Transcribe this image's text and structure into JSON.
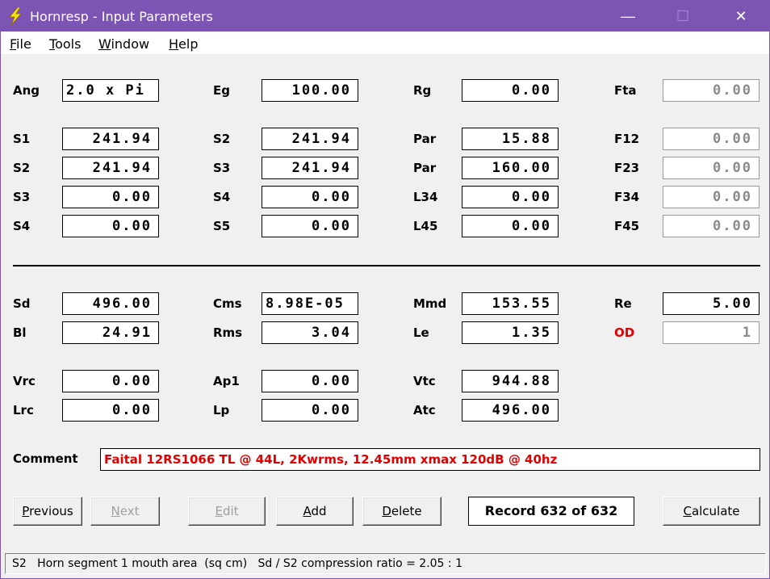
{
  "window": {
    "title": "Hornresp - Input Parameters",
    "icon": "lightning-bolt-icon",
    "title_bar_color": "#7b54b4",
    "minimize": "—",
    "maximize": "☐",
    "close": "✕"
  },
  "menu": {
    "file": {
      "key": "F",
      "rest": "ile"
    },
    "tools": {
      "key": "T",
      "rest": "ools"
    },
    "window": {
      "key": "W",
      "rest": "indow"
    },
    "help": {
      "key": "H",
      "rest": "elp"
    }
  },
  "params": {
    "ang": {
      "label": "Ang",
      "value": "2.0 x Pi"
    },
    "eg": {
      "label": "Eg",
      "value": "100.00"
    },
    "rg": {
      "label": "Rg",
      "value": "0.00"
    },
    "fta": {
      "label": "Fta",
      "value": "0.00"
    },
    "r1": [
      {
        "label": "S1",
        "value": "241.94"
      },
      {
        "label": "S2",
        "value": "241.94"
      },
      {
        "label": "Par",
        "value": "15.88"
      },
      {
        "label": "F12",
        "value": "0.00"
      }
    ],
    "r2": [
      {
        "label": "S2",
        "value": "241.94"
      },
      {
        "label": "S3",
        "value": "241.94"
      },
      {
        "label": "Par",
        "value": "160.00"
      },
      {
        "label": "F23",
        "value": "0.00"
      }
    ],
    "r3": [
      {
        "label": "S3",
        "value": "0.00"
      },
      {
        "label": "S4",
        "value": "0.00"
      },
      {
        "label": "L34",
        "value": "0.00"
      },
      {
        "label": "F34",
        "value": "0.00"
      }
    ],
    "r4": [
      {
        "label": "S4",
        "value": "0.00"
      },
      {
        "label": "S5",
        "value": "0.00"
      },
      {
        "label": "L45",
        "value": "0.00"
      },
      {
        "label": "F45",
        "value": "0.00"
      }
    ],
    "r5": [
      {
        "label": "Sd",
        "value": "496.00"
      },
      {
        "label": "Cms",
        "value": "8.98E-05"
      },
      {
        "label": "Mmd",
        "value": "153.55"
      },
      {
        "label": "Re",
        "value": "5.00"
      }
    ],
    "r6": [
      {
        "label": "Bl",
        "value": "24.91"
      },
      {
        "label": "Rms",
        "value": "3.04"
      },
      {
        "label": "Le",
        "value": "1.35"
      },
      {
        "label": "OD",
        "value": "1"
      }
    ],
    "r7": [
      {
        "label": "Vrc",
        "value": "0.00"
      },
      {
        "label": "Ap1",
        "value": "0.00"
      },
      {
        "label": "Vtc",
        "value": "944.88"
      }
    ],
    "r8": [
      {
        "label": "Lrc",
        "value": "0.00"
      },
      {
        "label": "Lp",
        "value": "0.00"
      },
      {
        "label": "Atc",
        "value": "496.00"
      }
    ]
  },
  "comment": {
    "label": "Comment",
    "value": "Faital 12RS1066 TL @ 44L, 2Kwrms, 12.45mm xmax 120dB @ 40hz"
  },
  "buttons": {
    "previous": {
      "key": "P",
      "rest": "revious"
    },
    "next": {
      "key": "N",
      "rest": "ext"
    },
    "edit": {
      "key": "E",
      "rest": "dit"
    },
    "add": {
      "key": "A",
      "rest": "dd"
    },
    "delete": {
      "key": "D",
      "rest": "elete"
    },
    "calculate": {
      "key": "C",
      "rest": "alculate"
    }
  },
  "record": "Record 632 of 632",
  "status": "S2   Horn segment 1 mouth area  (sq cm)   Sd / S2 compression ratio = 2.05 : 1",
  "colors": {
    "accent_red": "#e00000",
    "disabled_text": "#8a8a8a"
  }
}
